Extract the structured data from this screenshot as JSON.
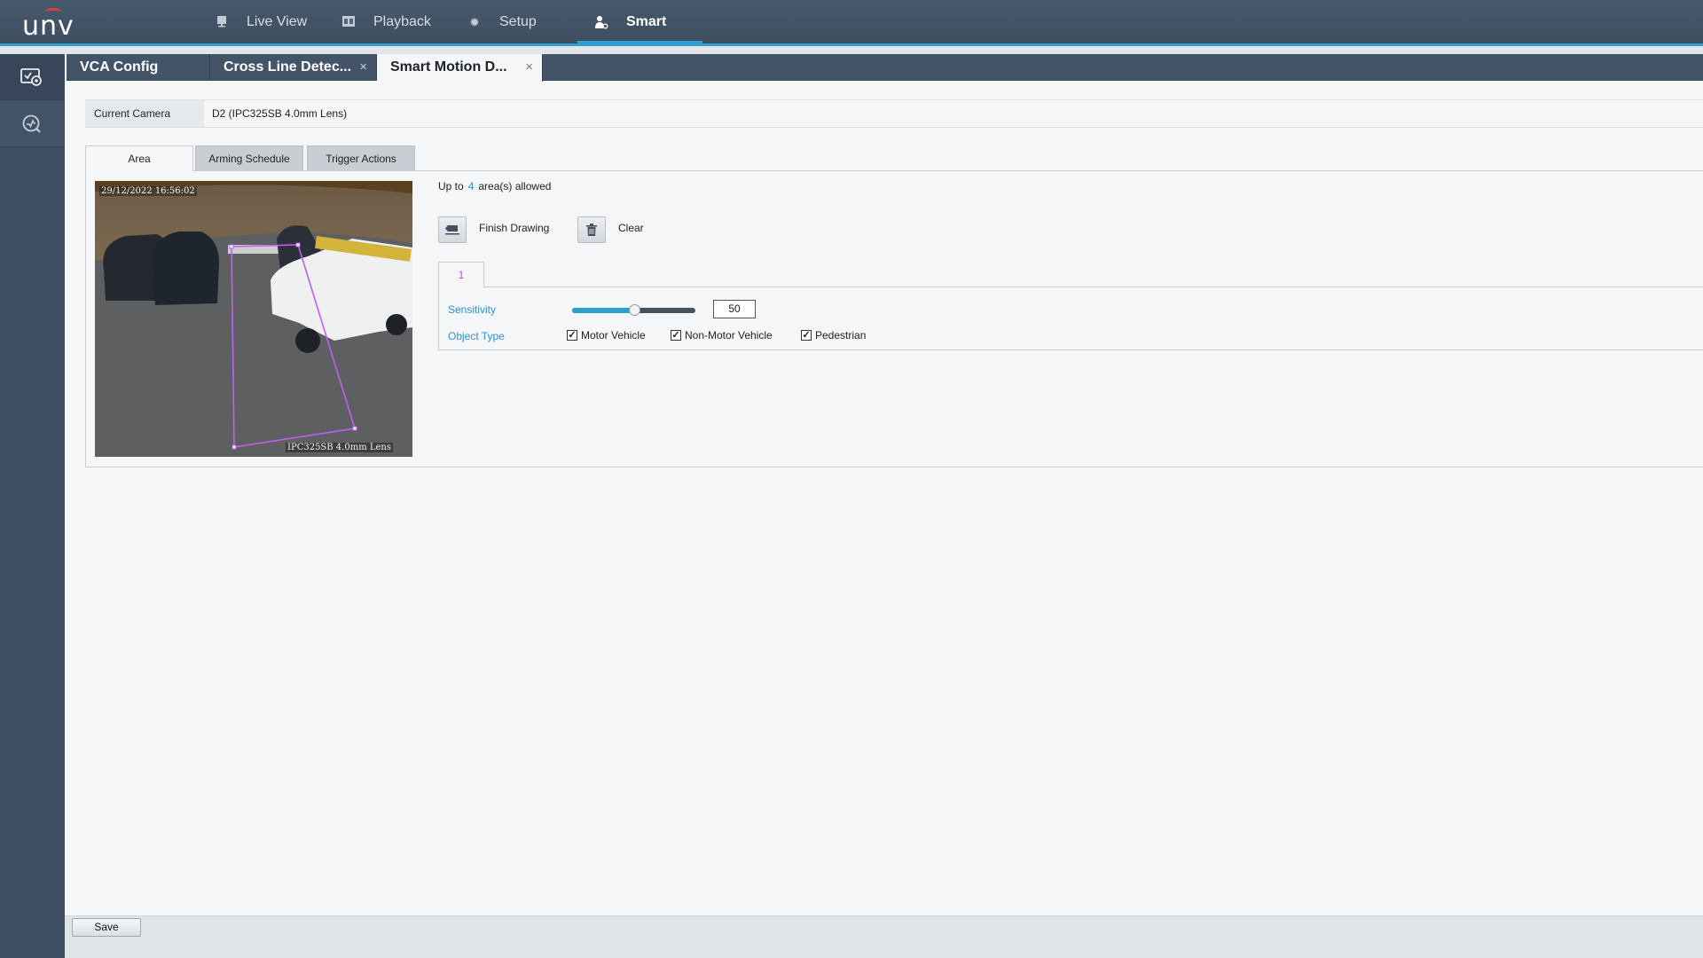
{
  "app": {
    "logo": "unv",
    "brand_color": "#2f9fd0"
  },
  "nav": [
    {
      "label": "Live View",
      "icon": "monitor-icon"
    },
    {
      "label": "Playback",
      "icon": "film-icon"
    },
    {
      "label": "Setup",
      "icon": "gear-icon"
    },
    {
      "label": "Smart",
      "icon": "person-camera-icon",
      "active": true
    }
  ],
  "sidebar": [
    {
      "icon": "vca-config-icon",
      "active": true
    },
    {
      "icon": "smart-search-icon"
    }
  ],
  "tabs": [
    {
      "label": "VCA Config",
      "closable": false
    },
    {
      "label": "Cross Line Detec...",
      "closable": true
    },
    {
      "label": "Smart Motion D...",
      "closable": true,
      "active": true
    }
  ],
  "close_glyph": "×",
  "camera": {
    "label": "Current Camera",
    "value": "D2 (IPC325SB 4.0mm Lens)"
  },
  "subtabs": [
    {
      "label": "Area",
      "active": true
    },
    {
      "label": "Arming Schedule"
    },
    {
      "label": "Trigger Actions"
    }
  ],
  "video": {
    "timestamp": "29/12/2022 16:56:02",
    "camera_osd": "IPC325SB 4.0mm Lens",
    "polygon_color": "#c060f0"
  },
  "areas": {
    "prefix": "Up to",
    "max": "4",
    "suffix": "area(s) allowed",
    "finish_label": "Finish Drawing",
    "clear_label": "Clear",
    "tabs": [
      "1"
    ]
  },
  "settings": {
    "sensitivity_label": "Sensitivity",
    "sensitivity_value": "50",
    "sensitivity_fraction": 0.5,
    "object_type_label": "Object Type",
    "object_types": [
      {
        "label": "Motor Vehicle",
        "checked": true
      },
      {
        "label": "Non-Motor Vehicle",
        "checked": true
      },
      {
        "label": "Pedestrian",
        "checked": true
      }
    ]
  },
  "footer": {
    "save_label": "Save"
  }
}
